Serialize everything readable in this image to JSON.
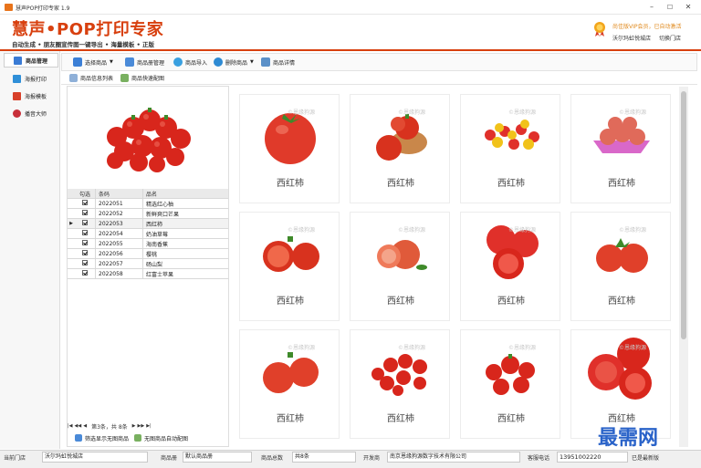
{
  "window": {
    "title": "慧声POP打印专家 1.9",
    "minimize": "–",
    "maximize": "☐",
    "close": "✕"
  },
  "header": {
    "logo": "慧声•POP打印专家",
    "slogan": "自动生成 • 朋友圈宣传图一键导出 • 海量模板 • 正版",
    "vip_text": "尚佳版VIP会员，已自动激活",
    "user_name": "沃尔玛虹悦城店",
    "switch_store": "切换门店"
  },
  "sidebar": {
    "items": [
      {
        "label": "商品管理",
        "icon": "product-icon",
        "color": "#3a7bd5"
      },
      {
        "label": "海报打印",
        "icon": "print-icon",
        "color": "#2f8fd8"
      },
      {
        "label": "海报模板",
        "icon": "template-icon",
        "color": "#d8402a"
      },
      {
        "label": "播音大师",
        "icon": "broadcast-icon",
        "color": "#c8303a"
      }
    ]
  },
  "toolbar": {
    "select_products": "选择商品",
    "catalog_manage": "商品册管理",
    "import_products": "商品导入",
    "delete_products": "删除商品",
    "product_detail": "商品详情"
  },
  "subtabs": {
    "list": "商品信息列表",
    "quick_image": "商品快速配图"
  },
  "table": {
    "headers": [
      "",
      "勾选",
      "条码",
      "品名"
    ],
    "rows": [
      {
        "code": "2022051",
        "name": "精选红心柚",
        "selected": false
      },
      {
        "code": "2022052",
        "name": "新鲜爽口芒果",
        "selected": false
      },
      {
        "code": "2022053",
        "name": "西红柿",
        "selected": true
      },
      {
        "code": "2022054",
        "name": "奶油草莓",
        "selected": false
      },
      {
        "code": "2022055",
        "name": "海南香蕉",
        "selected": false
      },
      {
        "code": "2022056",
        "name": "樱桃",
        "selected": false
      },
      {
        "code": "2022057",
        "name": "砀山梨",
        "selected": false
      },
      {
        "code": "2022058",
        "name": "红富士苹果",
        "selected": false
      }
    ]
  },
  "pager": {
    "text": "第3条，共 8条",
    "first": "|◀",
    "prev": "◀◀",
    "back": "◀",
    "next": "▶",
    "fwd": "▶▶",
    "last": "▶|"
  },
  "bottom": {
    "show_no_image": "筛选显示无图商品",
    "auto_image": "无图商品自动配图"
  },
  "grid": {
    "caption": "西红柿",
    "watermark": "©恩缘狗源"
  },
  "status": {
    "store_label": "当前门店",
    "store_value": "沃尔玛虹悦城店",
    "catalog_label": "商品册",
    "catalog_value": "默认商品册",
    "count_label": "商品总数",
    "count_value": "共8条",
    "dev_label": "开发商",
    "dev_value": "南京恩缘狗源数字技术有限公司",
    "phone_label": "客服电话",
    "phone_value": "13951002220",
    "latest": "已是最新版"
  },
  "site_watermark": "最需网",
  "colors": {
    "accent": "#d8400f",
    "tomato": "#e03a2a"
  }
}
